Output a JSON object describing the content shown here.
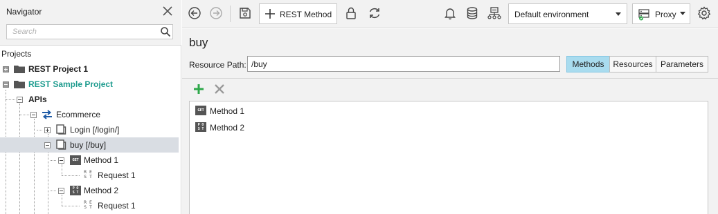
{
  "navigator": {
    "title": "Navigator",
    "search_placeholder": "Search",
    "projects_label": "Projects",
    "tree": {
      "rest_project_1": "REST Project 1",
      "rest_sample_project": "REST Sample Project",
      "apis": "APIs",
      "ecommerce": "Ecommerce",
      "login": "Login [/login/]",
      "buy": "buy [/buy]",
      "method_1": "Method 1",
      "request_1a": "Request 1",
      "method_2": "Method 2",
      "request_1b": "Request 1"
    },
    "badges": {
      "get": "GET",
      "post": "POST"
    }
  },
  "toolbar": {
    "rest_method_label": "REST Method",
    "environment": "Default environment",
    "proxy_label": "Proxy"
  },
  "resource": {
    "title": "buy",
    "path_label": "Resource Path:",
    "path_value": "/buy",
    "tabs": [
      "Methods",
      "Resources",
      "Parameters"
    ],
    "active_tab": "Methods",
    "methods": [
      {
        "name": "Method 1",
        "verb": "GET"
      },
      {
        "name": "Method 2",
        "verb": "POST"
      }
    ]
  },
  "colors": {
    "accent_teal": "#1f9c8f",
    "active_tab": "#a9dcef",
    "selected_row": "#d9dde3",
    "add_green": "#2ea84a",
    "toolbar_bg": "#f2f2f2"
  },
  "icons": [
    "close-icon",
    "search-icon",
    "folder-icon",
    "back-icon",
    "forward-icon",
    "save-icon",
    "lock-icon",
    "refresh-icon",
    "bell-icon",
    "database-icon",
    "api-icon",
    "proxy-icon",
    "gear-icon",
    "add-icon",
    "delete-icon",
    "get-badge-icon",
    "post-badge-icon",
    "rest-request-icon"
  ]
}
